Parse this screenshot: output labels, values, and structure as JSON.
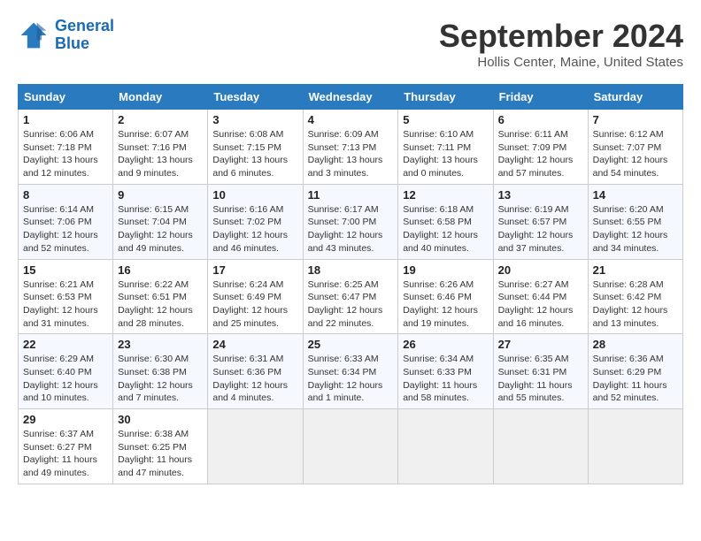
{
  "header": {
    "logo_line1": "General",
    "logo_line2": "Blue",
    "month": "September 2024",
    "location": "Hollis Center, Maine, United States"
  },
  "weekdays": [
    "Sunday",
    "Monday",
    "Tuesday",
    "Wednesday",
    "Thursday",
    "Friday",
    "Saturday"
  ],
  "weeks": [
    [
      {
        "day": "1",
        "info": "Sunrise: 6:06 AM\nSunset: 7:18 PM\nDaylight: 13 hours\nand 12 minutes."
      },
      {
        "day": "2",
        "info": "Sunrise: 6:07 AM\nSunset: 7:16 PM\nDaylight: 13 hours\nand 9 minutes."
      },
      {
        "day": "3",
        "info": "Sunrise: 6:08 AM\nSunset: 7:15 PM\nDaylight: 13 hours\nand 6 minutes."
      },
      {
        "day": "4",
        "info": "Sunrise: 6:09 AM\nSunset: 7:13 PM\nDaylight: 13 hours\nand 3 minutes."
      },
      {
        "day": "5",
        "info": "Sunrise: 6:10 AM\nSunset: 7:11 PM\nDaylight: 13 hours\nand 0 minutes."
      },
      {
        "day": "6",
        "info": "Sunrise: 6:11 AM\nSunset: 7:09 PM\nDaylight: 12 hours\nand 57 minutes."
      },
      {
        "day": "7",
        "info": "Sunrise: 6:12 AM\nSunset: 7:07 PM\nDaylight: 12 hours\nand 54 minutes."
      }
    ],
    [
      {
        "day": "8",
        "info": "Sunrise: 6:14 AM\nSunset: 7:06 PM\nDaylight: 12 hours\nand 52 minutes."
      },
      {
        "day": "9",
        "info": "Sunrise: 6:15 AM\nSunset: 7:04 PM\nDaylight: 12 hours\nand 49 minutes."
      },
      {
        "day": "10",
        "info": "Sunrise: 6:16 AM\nSunset: 7:02 PM\nDaylight: 12 hours\nand 46 minutes."
      },
      {
        "day": "11",
        "info": "Sunrise: 6:17 AM\nSunset: 7:00 PM\nDaylight: 12 hours\nand 43 minutes."
      },
      {
        "day": "12",
        "info": "Sunrise: 6:18 AM\nSunset: 6:58 PM\nDaylight: 12 hours\nand 40 minutes."
      },
      {
        "day": "13",
        "info": "Sunrise: 6:19 AM\nSunset: 6:57 PM\nDaylight: 12 hours\nand 37 minutes."
      },
      {
        "day": "14",
        "info": "Sunrise: 6:20 AM\nSunset: 6:55 PM\nDaylight: 12 hours\nand 34 minutes."
      }
    ],
    [
      {
        "day": "15",
        "info": "Sunrise: 6:21 AM\nSunset: 6:53 PM\nDaylight: 12 hours\nand 31 minutes."
      },
      {
        "day": "16",
        "info": "Sunrise: 6:22 AM\nSunset: 6:51 PM\nDaylight: 12 hours\nand 28 minutes."
      },
      {
        "day": "17",
        "info": "Sunrise: 6:24 AM\nSunset: 6:49 PM\nDaylight: 12 hours\nand 25 minutes."
      },
      {
        "day": "18",
        "info": "Sunrise: 6:25 AM\nSunset: 6:47 PM\nDaylight: 12 hours\nand 22 minutes."
      },
      {
        "day": "19",
        "info": "Sunrise: 6:26 AM\nSunset: 6:46 PM\nDaylight: 12 hours\nand 19 minutes."
      },
      {
        "day": "20",
        "info": "Sunrise: 6:27 AM\nSunset: 6:44 PM\nDaylight: 12 hours\nand 16 minutes."
      },
      {
        "day": "21",
        "info": "Sunrise: 6:28 AM\nSunset: 6:42 PM\nDaylight: 12 hours\nand 13 minutes."
      }
    ],
    [
      {
        "day": "22",
        "info": "Sunrise: 6:29 AM\nSunset: 6:40 PM\nDaylight: 12 hours\nand 10 minutes."
      },
      {
        "day": "23",
        "info": "Sunrise: 6:30 AM\nSunset: 6:38 PM\nDaylight: 12 hours\nand 7 minutes."
      },
      {
        "day": "24",
        "info": "Sunrise: 6:31 AM\nSunset: 6:36 PM\nDaylight: 12 hours\nand 4 minutes."
      },
      {
        "day": "25",
        "info": "Sunrise: 6:33 AM\nSunset: 6:34 PM\nDaylight: 12 hours\nand 1 minute."
      },
      {
        "day": "26",
        "info": "Sunrise: 6:34 AM\nSunset: 6:33 PM\nDaylight: 11 hours\nand 58 minutes."
      },
      {
        "day": "27",
        "info": "Sunrise: 6:35 AM\nSunset: 6:31 PM\nDaylight: 11 hours\nand 55 minutes."
      },
      {
        "day": "28",
        "info": "Sunrise: 6:36 AM\nSunset: 6:29 PM\nDaylight: 11 hours\nand 52 minutes."
      }
    ],
    [
      {
        "day": "29",
        "info": "Sunrise: 6:37 AM\nSunset: 6:27 PM\nDaylight: 11 hours\nand 49 minutes."
      },
      {
        "day": "30",
        "info": "Sunrise: 6:38 AM\nSunset: 6:25 PM\nDaylight: 11 hours\nand 47 minutes."
      },
      {
        "day": "",
        "info": ""
      },
      {
        "day": "",
        "info": ""
      },
      {
        "day": "",
        "info": ""
      },
      {
        "day": "",
        "info": ""
      },
      {
        "day": "",
        "info": ""
      }
    ]
  ]
}
